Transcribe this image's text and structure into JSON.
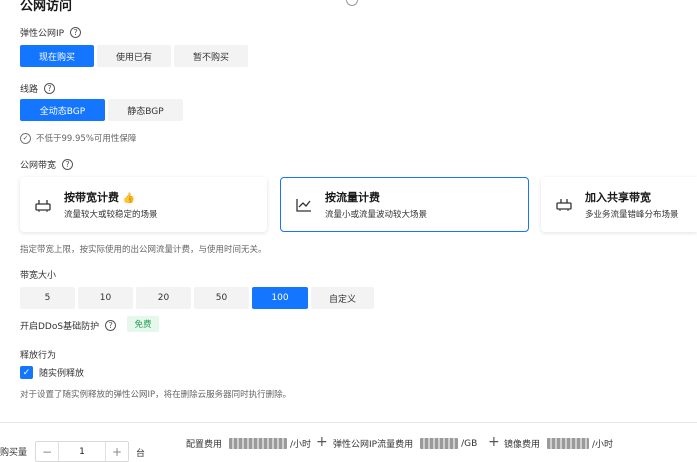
{
  "section_title": "公网访问",
  "eip": {
    "label": "弹性公网IP",
    "options": [
      "现在购买",
      "使用已有",
      "暂不购买"
    ]
  },
  "line": {
    "label": "线路",
    "options": [
      "全动态BGP",
      "静态BGP"
    ],
    "guarantee_note": "不低于99.95%可用性保障"
  },
  "bandwidth": {
    "label": "公网带宽",
    "cards": [
      {
        "title": "按带宽计费",
        "desc": "流量较大或较稳定的场景",
        "icon": "router-icon",
        "hot_icon": "thumb-up-icon"
      },
      {
        "title": "按流量计费",
        "desc": "流量小或流量波动较大场景",
        "icon": "line-chart-icon"
      },
      {
        "title": "加入共享带宽",
        "desc": "多业务流量错峰分布场景",
        "icon": "shared-router-icon"
      }
    ],
    "note": "指定带宽上限，按实际使用的出公网流量计费，与使用时间无关。"
  },
  "bandwidth_size": {
    "label": "带宽大小",
    "options": [
      "5",
      "10",
      "20",
      "50",
      "100",
      "自定义"
    ]
  },
  "ddos": {
    "label": "开启DDoS基础防护",
    "badge": "免费"
  },
  "release": {
    "label": "释放行为",
    "checkbox_label": "随实例释放",
    "note": "对于设置了随实例释放的弹性公网IP，将在删除云服务器同时执行删除。"
  },
  "footer": {
    "qty_label": "购买量",
    "qty_value": "1",
    "unit": "台",
    "config_fee": "配置费用",
    "per_hour": "/小时",
    "eip_fee": "弹性公网IP流量费用",
    "per_gb": "/GB",
    "image_fee": "镜像费用",
    "per_hour2": "/小时",
    "plus": "+",
    "minus": "−",
    "inc": "+"
  },
  "colors": {
    "accent": "#1476ff",
    "free_bg": "#e6f7ec",
    "free_text": "#2aa159"
  }
}
